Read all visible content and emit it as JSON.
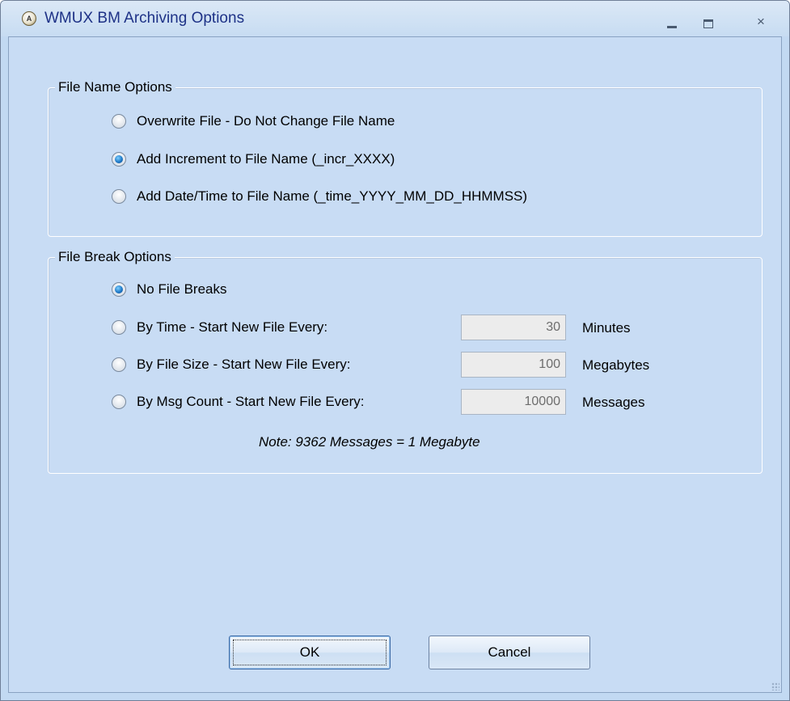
{
  "window": {
    "title": "WMUX BM Archiving Options",
    "icon": "app-icon",
    "icon_text": "A",
    "controls": {
      "minimize": "minimize-icon",
      "maximize": "maximize-icon",
      "close": "×"
    }
  },
  "file_name_options": {
    "legend": "File Name Options",
    "options": [
      {
        "label": "Overwrite File - Do Not Change File Name",
        "checked": false
      },
      {
        "label": "Add Increment to File Name (_incr_XXXX)",
        "checked": true
      },
      {
        "label": "Add Date/Time to File Name (_time_YYYY_MM_DD_HHMMSS)",
        "checked": false
      }
    ]
  },
  "file_break_options": {
    "legend": "File Break Options",
    "options": [
      {
        "label": "No File Breaks",
        "checked": true
      },
      {
        "label": "By Time - Start New File Every:",
        "checked": false,
        "value": "30",
        "unit": "Minutes"
      },
      {
        "label": "By File Size - Start New File Every:",
        "checked": false,
        "value": "100",
        "unit": "Megabytes"
      },
      {
        "label": "By Msg Count - Start New File Every:",
        "checked": false,
        "value": "10000",
        "unit": "Messages"
      }
    ],
    "note": "Note:  9362 Messages = 1 Megabyte"
  },
  "buttons": {
    "ok": "OK",
    "cancel": "Cancel"
  },
  "colors": {
    "title_text": "#1e3287",
    "background": "#c8dcf4",
    "radio_checked": "#1f7ac8"
  }
}
